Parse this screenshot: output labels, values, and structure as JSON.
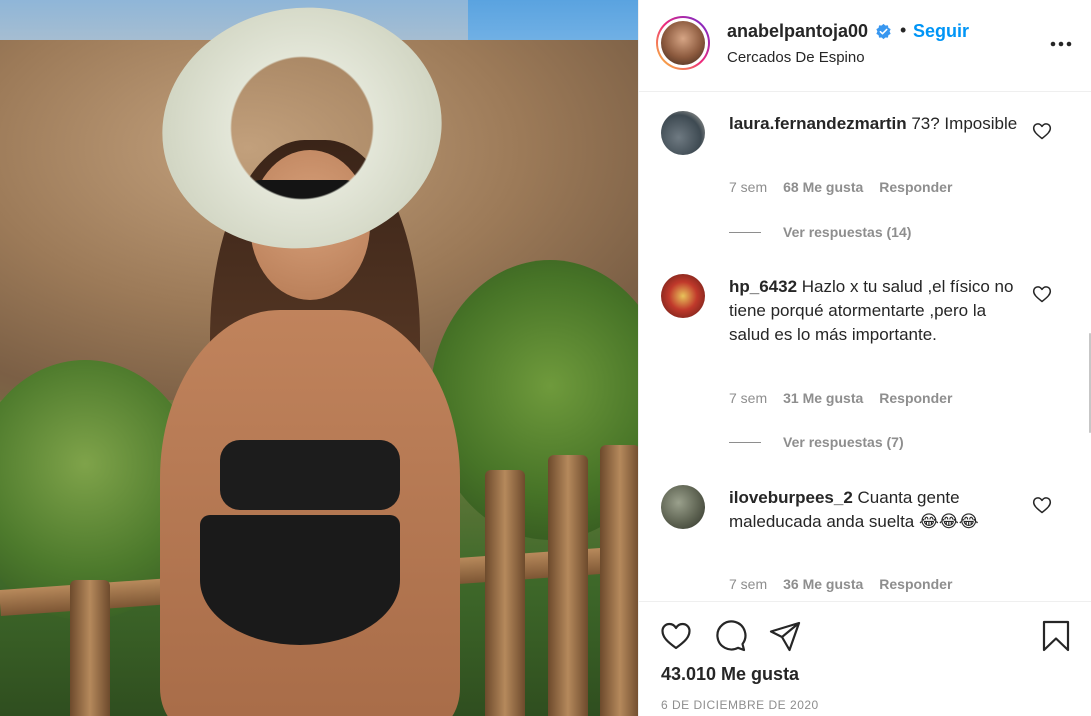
{
  "post": {
    "username": "anabelpantoja00",
    "verified": true,
    "separator": "•",
    "follow_label": "Seguir",
    "location": "Cercados De Espino",
    "more_icon": "more-options-icon"
  },
  "comments": [
    {
      "username": "laura.fernandezmartin",
      "text": "73? Imposible",
      "time": "7 sem",
      "likes": "68 Me gusta",
      "reply": "Responder",
      "view_replies": "Ver respuestas (14)"
    },
    {
      "username": "hp_6432",
      "text": "Hazlo x tu salud ,el físico no tiene porqué atormentarte ,pero la salud es lo más importante.",
      "time": "7 sem",
      "likes": "31 Me gusta",
      "reply": "Responder",
      "view_replies": "Ver respuestas (7)"
    },
    {
      "username": "iloveburpees_2",
      "text": "Cuanta gente maleducada anda suelta",
      "emojis": "😂😂😂",
      "time": "7 sem",
      "likes": "36 Me gusta",
      "reply": "Responder"
    }
  ],
  "footer": {
    "likes_total": "43.010 Me gusta",
    "date": "6 DE DICIEMBRE DE 2020"
  },
  "colors": {
    "accent": "#0095f6",
    "text": "#262626",
    "muted": "#8e8e8e",
    "border": "#efefef"
  }
}
